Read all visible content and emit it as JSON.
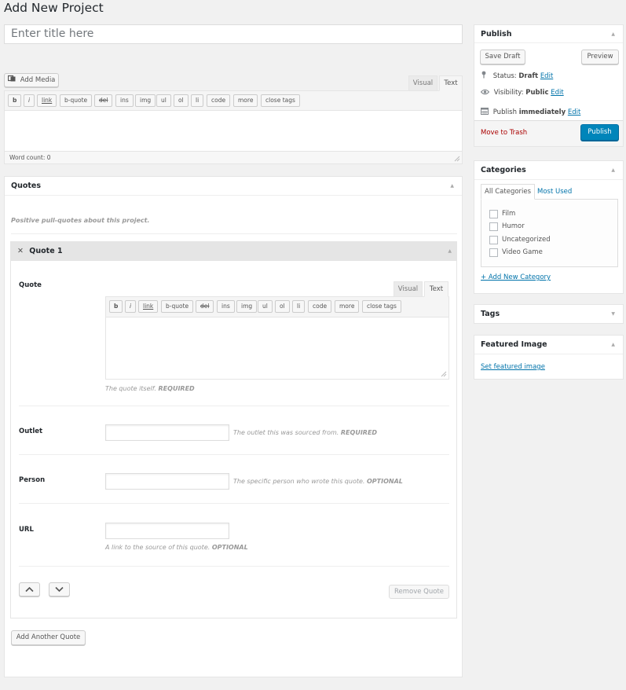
{
  "page": {
    "title": "Add New Project"
  },
  "title_field": {
    "placeholder": "Enter title here"
  },
  "editor": {
    "add_media": "Add Media",
    "tabs": [
      "Visual",
      "Text"
    ],
    "quicktags": [
      "b",
      "i",
      "link",
      "b-quote",
      "del",
      "ins",
      "img",
      "ul",
      "ol",
      "li",
      "code",
      "more",
      "close tags"
    ],
    "word_count": "Word count: 0"
  },
  "quotes_box": {
    "title": "Quotes",
    "description": "Positive pull-quotes about this project.",
    "quote_group": {
      "title": "Quote 1",
      "quote": {
        "label": "Quote",
        "tabs": [
          "Visual",
          "Text"
        ],
        "quicktags": [
          "b",
          "i",
          "link",
          "b-quote",
          "del",
          "ins",
          "img",
          "ul",
          "ol",
          "li",
          "code",
          "more",
          "close tags"
        ],
        "desc": "The quote itself.",
        "req": "REQUIRED"
      },
      "outlet": {
        "label": "Outlet",
        "desc": "The outlet this was sourced from.",
        "req": "REQUIRED"
      },
      "person": {
        "label": "Person",
        "desc": "The specific person who wrote this quote.",
        "req": "OPTIONAL"
      },
      "url": {
        "label": "URL",
        "desc": "A link to the source of this quote.",
        "req": "OPTIONAL"
      },
      "remove": "Remove Quote"
    },
    "add_another": "Add Another Quote"
  },
  "publish": {
    "title": "Publish",
    "save_draft": "Save Draft",
    "preview": "Preview",
    "status_label": "Status:",
    "status_value": "Draft",
    "visibility_label": "Visibility:",
    "visibility_value": "Public",
    "publish_label": "Publish",
    "publish_value": "immediately",
    "edit": "Edit",
    "trash": "Move to Trash",
    "publish_btn": "Publish"
  },
  "categories": {
    "title": "Categories",
    "tabs": [
      "All Categories",
      "Most Used"
    ],
    "items": [
      "Film",
      "Humor",
      "Uncategorized",
      "Video Game"
    ],
    "add_new": "+ Add New Category"
  },
  "tags": {
    "title": "Tags"
  },
  "featured": {
    "title": "Featured Image",
    "link": "Set featured image"
  },
  "colors": {
    "accent": "#0085ba",
    "link": "#0073aa",
    "trash": "#a00"
  }
}
